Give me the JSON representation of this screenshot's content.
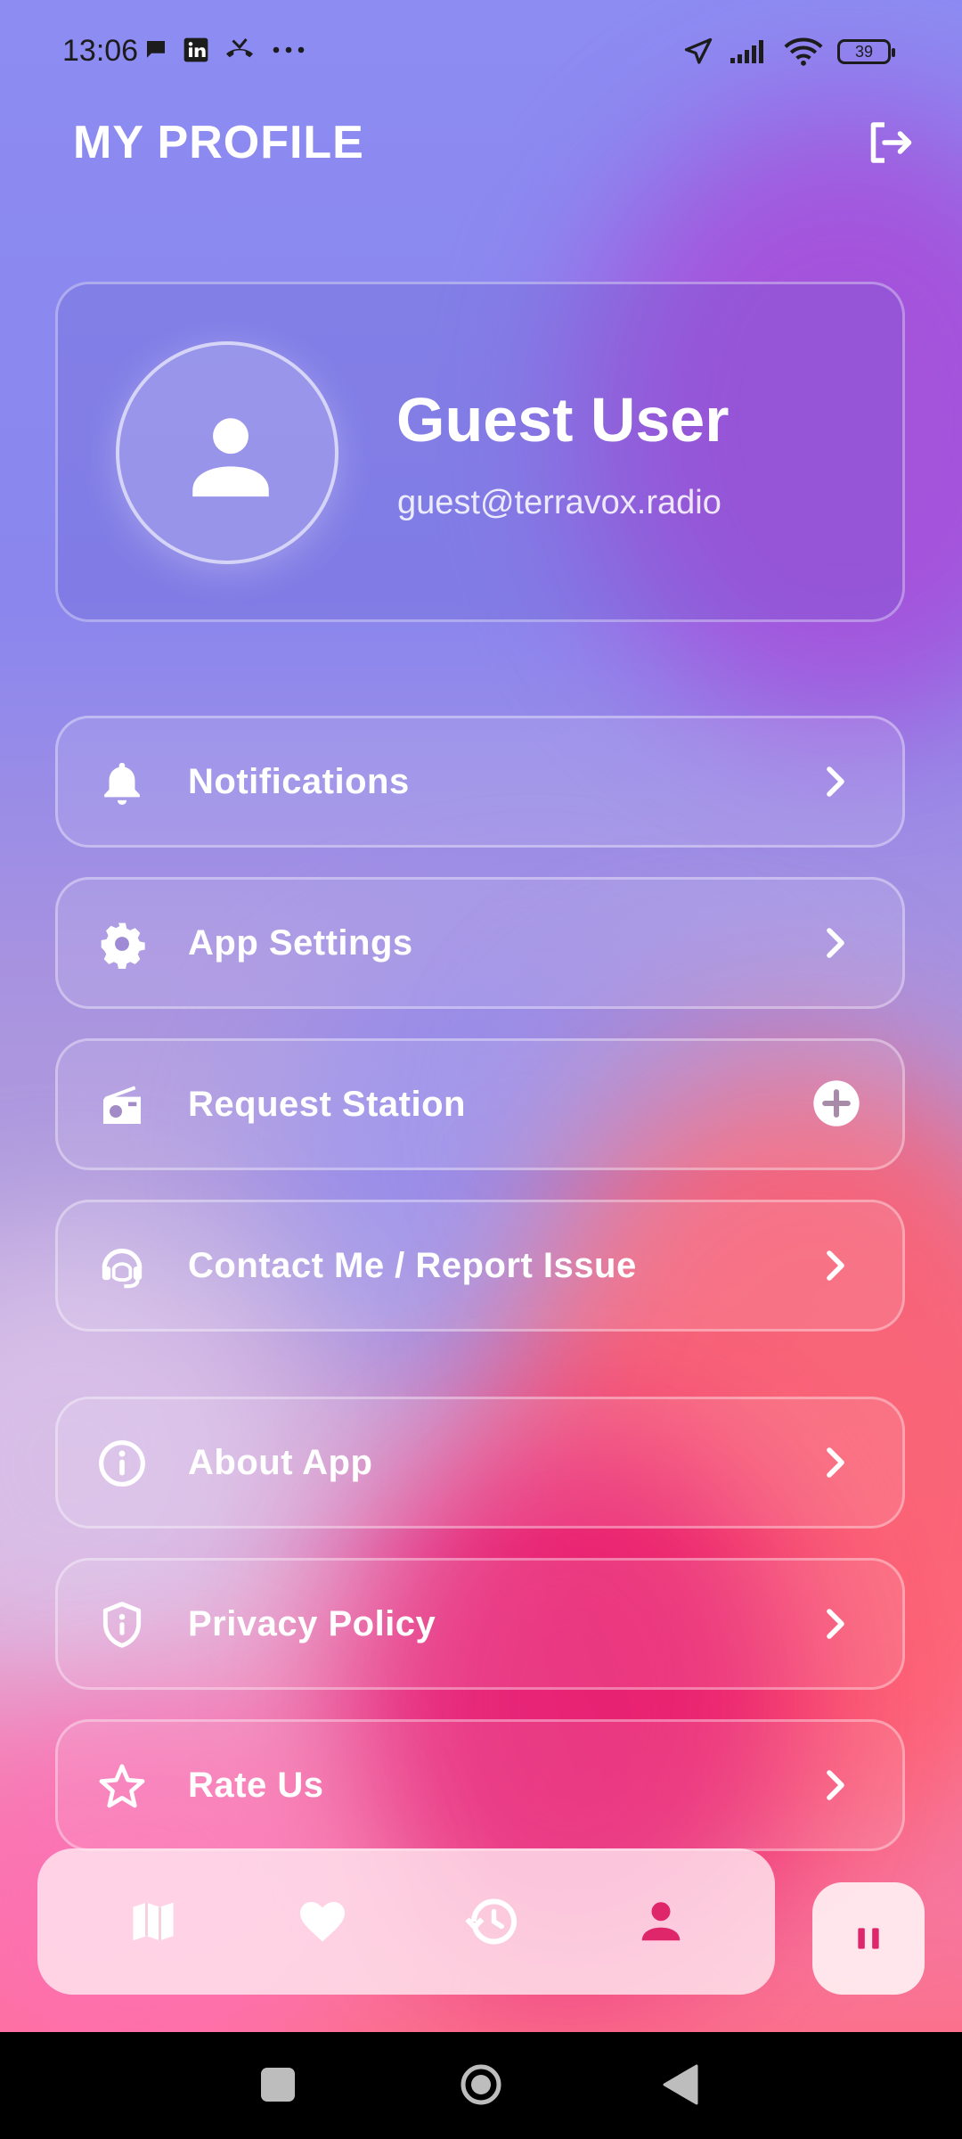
{
  "status_bar": {
    "time": "13:06",
    "battery": "39",
    "left_icons": [
      "chat-icon",
      "linkedin-icon",
      "missed-call-icon",
      "more-dots-icon"
    ],
    "right_icons": [
      "location-arrow-icon",
      "signal-icon",
      "wifi-icon",
      "battery-icon"
    ]
  },
  "header": {
    "title": "MY PROFILE",
    "action_icon": "logout-icon"
  },
  "profile": {
    "name": "Guest User",
    "email": "guest@terravox.radio"
  },
  "menu": [
    {
      "label": "Notifications",
      "icon": "bell-icon",
      "trailing": "chevron-right-icon"
    },
    {
      "label": "App Settings",
      "icon": "gear-icon",
      "trailing": "chevron-right-icon"
    },
    {
      "label": "Request Station",
      "icon": "radio-icon",
      "trailing": "add-circle-icon"
    },
    {
      "label": "Contact Me / Report Issue",
      "icon": "headset-icon",
      "trailing": "chevron-right-icon"
    },
    {
      "label": "About App",
      "icon": "info-icon",
      "trailing": "chevron-right-icon"
    },
    {
      "label": "Privacy Policy",
      "icon": "shield-info-icon",
      "trailing": "chevron-right-icon"
    },
    {
      "label": "Rate Us",
      "icon": "star-icon",
      "trailing": "chevron-right-icon"
    }
  ],
  "bottom_nav": {
    "items": [
      "map-icon",
      "heart-icon",
      "history-icon",
      "person-icon"
    ],
    "active": "person-icon",
    "active_color": "#e0266a",
    "inactive_color": "#ffffff"
  },
  "player": {
    "state_icon": "pause-icon",
    "color": "#e0266a"
  },
  "system_nav": [
    "recents-square-icon",
    "home-circle-icon",
    "back-triangle-icon"
  ]
}
